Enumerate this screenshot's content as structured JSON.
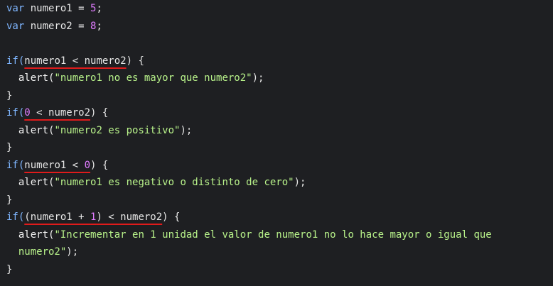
{
  "editor": {
    "lines": [
      {
        "parts": [
          {
            "t": "var ",
            "c": "kw"
          },
          {
            "t": "numero1 = ",
            "c": "plain"
          },
          {
            "t": "5",
            "c": "num"
          },
          {
            "t": ";",
            "c": "plain"
          }
        ]
      },
      {
        "parts": [
          {
            "t": "var ",
            "c": "kw"
          },
          {
            "t": "numero2 = ",
            "c": "plain"
          },
          {
            "t": "8",
            "c": "num"
          },
          {
            "t": ";",
            "c": "plain"
          }
        ]
      },
      {
        "parts": []
      },
      {
        "parts": [
          {
            "t": "if(",
            "c": "kw"
          },
          {
            "t": "numero1 < numero2",
            "c": "plain",
            "u": true
          },
          {
            "t": ") {",
            "c": "plain"
          }
        ]
      },
      {
        "parts": [
          {
            "t": "  alert(",
            "c": "fn"
          },
          {
            "t": "\"numero1 no es mayor que numero2\"",
            "c": "str"
          },
          {
            "t": ");",
            "c": "plain"
          }
        ]
      },
      {
        "parts": [
          {
            "t": "}",
            "c": "brace"
          }
        ]
      },
      {
        "parts": [
          {
            "t": "if(",
            "c": "kw"
          },
          {
            "t": "0",
            "c": "num",
            "u": true
          },
          {
            "t": " < numero2",
            "c": "plain",
            "u": true
          },
          {
            "t": ") {",
            "c": "plain"
          }
        ]
      },
      {
        "parts": [
          {
            "t": "  alert(",
            "c": "fn"
          },
          {
            "t": "\"numero2 es positivo\"",
            "c": "str"
          },
          {
            "t": ");",
            "c": "plain"
          }
        ]
      },
      {
        "parts": [
          {
            "t": "}",
            "c": "brace"
          }
        ]
      },
      {
        "parts": [
          {
            "t": "if(",
            "c": "kw"
          },
          {
            "t": "numero1 < ",
            "c": "plain",
            "u": true
          },
          {
            "t": "0",
            "c": "num",
            "u": true
          },
          {
            "t": ") {",
            "c": "plain"
          }
        ]
      },
      {
        "parts": [
          {
            "t": "  alert(",
            "c": "fn"
          },
          {
            "t": "\"numero1 es negativo o distinto de cero\"",
            "c": "str"
          },
          {
            "t": ");",
            "c": "plain"
          }
        ]
      },
      {
        "parts": [
          {
            "t": "}",
            "c": "brace"
          }
        ]
      },
      {
        "parts": [
          {
            "t": "if(",
            "c": "kw"
          },
          {
            "t": "(numero1 + ",
            "c": "plain",
            "u": true
          },
          {
            "t": "1",
            "c": "num",
            "u": true
          },
          {
            "t": ") < numero2",
            "c": "plain",
            "u": true
          },
          {
            "t": ") {",
            "c": "plain"
          }
        ]
      },
      {
        "parts": [
          {
            "t": "  alert(",
            "c": "fn"
          },
          {
            "t": "\"Incrementar en 1 unidad el valor de numero1 no lo hace mayor o igual que",
            "c": "str"
          }
        ]
      },
      {
        "parts": [
          {
            "t": "  numero2\"",
            "c": "str"
          },
          {
            "t": ");",
            "c": "plain"
          }
        ]
      },
      {
        "parts": [
          {
            "t": "}",
            "c": "brace"
          }
        ]
      }
    ]
  },
  "colors": {
    "background": "#1e1f22",
    "keyword": "#7fb6ff",
    "number": "#e07cff",
    "string": "#b8f28a",
    "text": "#e6e6e6",
    "underline": "#e01b1b"
  }
}
